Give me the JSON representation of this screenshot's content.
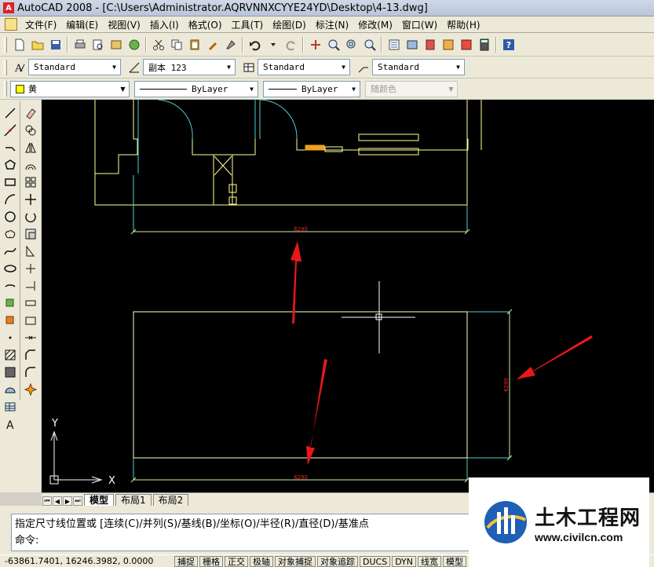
{
  "window": {
    "app_logo": "A",
    "title": "AutoCAD 2008 - [C:\\Users\\Administrator.AQRVNNXCYYE24YD\\Desktop\\4-13.dwg]"
  },
  "menu": {
    "items": [
      "文件(F)",
      "编辑(E)",
      "视图(V)",
      "插入(I)",
      "格式(O)",
      "工具(T)",
      "绘图(D)",
      "标注(N)",
      "修改(M)",
      "窗口(W)",
      "帮助(H)"
    ]
  },
  "styles_toolbar": {
    "text_style": "Standard",
    "dim_style": "副本 123",
    "table_style": "Standard",
    "multileader_style": "Standard"
  },
  "properties_toolbar": {
    "color": "黄",
    "linetype": "ByLayer",
    "lineweight": "ByLayer",
    "plot_style": "随颜色"
  },
  "drawing": {
    "dimension_top": "6290",
    "dimension_bottom": "6290",
    "dimension_right": "6290",
    "ucs_y": "Y",
    "ucs_x": "X",
    "colors": {
      "background": "#000000",
      "geometry": "#ffff99",
      "dimension_line": "#c8f0a0",
      "extension_line": "#4fd0d0",
      "dimension_text": "#ff2020",
      "annotation_arrow": "#e81818",
      "crosshair": "#ffffff"
    }
  },
  "tabs": {
    "model": "模型",
    "layout1": "布局1",
    "layout2": "布局2"
  },
  "command": {
    "line1": "指定尺寸线位置或 [连续(C)/并列(S)/基线(B)/坐标(O)/半径(R)/直径(D)/基准点",
    "line2": "命令:"
  },
  "status": {
    "coords": "-63861.7401, 16246.3982, 0.0000",
    "buttons": [
      "捕捉",
      "栅格",
      "正交",
      "极轴",
      "对象捕捉",
      "对象追踪",
      "DUCS",
      "DYN",
      "线宽",
      "模型"
    ]
  },
  "watermark": {
    "name": "土木工程网",
    "url": "www.civilcn.com"
  }
}
